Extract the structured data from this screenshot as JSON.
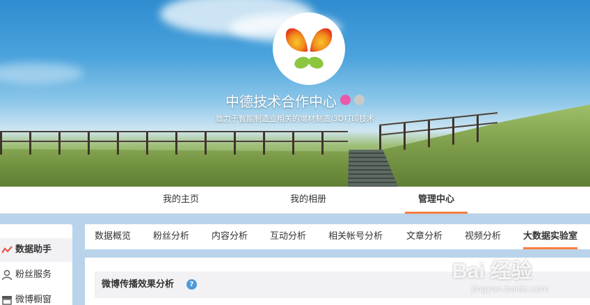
{
  "profile": {
    "name": "中德技术合作中心",
    "description": "致力于智能制造业相关的增材制造/3D打印技术",
    "badge_colors": [
      "#e85aa7",
      "#c9c9c9"
    ]
  },
  "nav": {
    "items": [
      {
        "label": "我的主页",
        "icon": "none"
      },
      {
        "label": "我的相册",
        "icon": "none"
      },
      {
        "label": "管理中心",
        "icon": "none",
        "active": true
      }
    ]
  },
  "sidebar": {
    "items": [
      {
        "label": "数据助手",
        "icon": "chart-line-icon",
        "active": true
      },
      {
        "label": "粉丝服务",
        "icon": "user-icon"
      },
      {
        "label": "微博橱窗",
        "icon": "store-icon"
      }
    ]
  },
  "tabs": [
    {
      "label": "数据概览"
    },
    {
      "label": "粉丝分析"
    },
    {
      "label": "内容分析"
    },
    {
      "label": "互动分析"
    },
    {
      "label": "相关帐号分析"
    },
    {
      "label": "文章分析"
    },
    {
      "label": "视频分析"
    },
    {
      "label": "大数据实验室",
      "active": true
    }
  ],
  "panel": {
    "title": "微博传播效果分析",
    "help_icon": "?"
  },
  "watermark": {
    "brand": "Bai 经验",
    "url": "jingyan.baidu.com"
  },
  "colors": {
    "accent": "#fa7d3c",
    "help_blue": "#4f9ad8"
  }
}
